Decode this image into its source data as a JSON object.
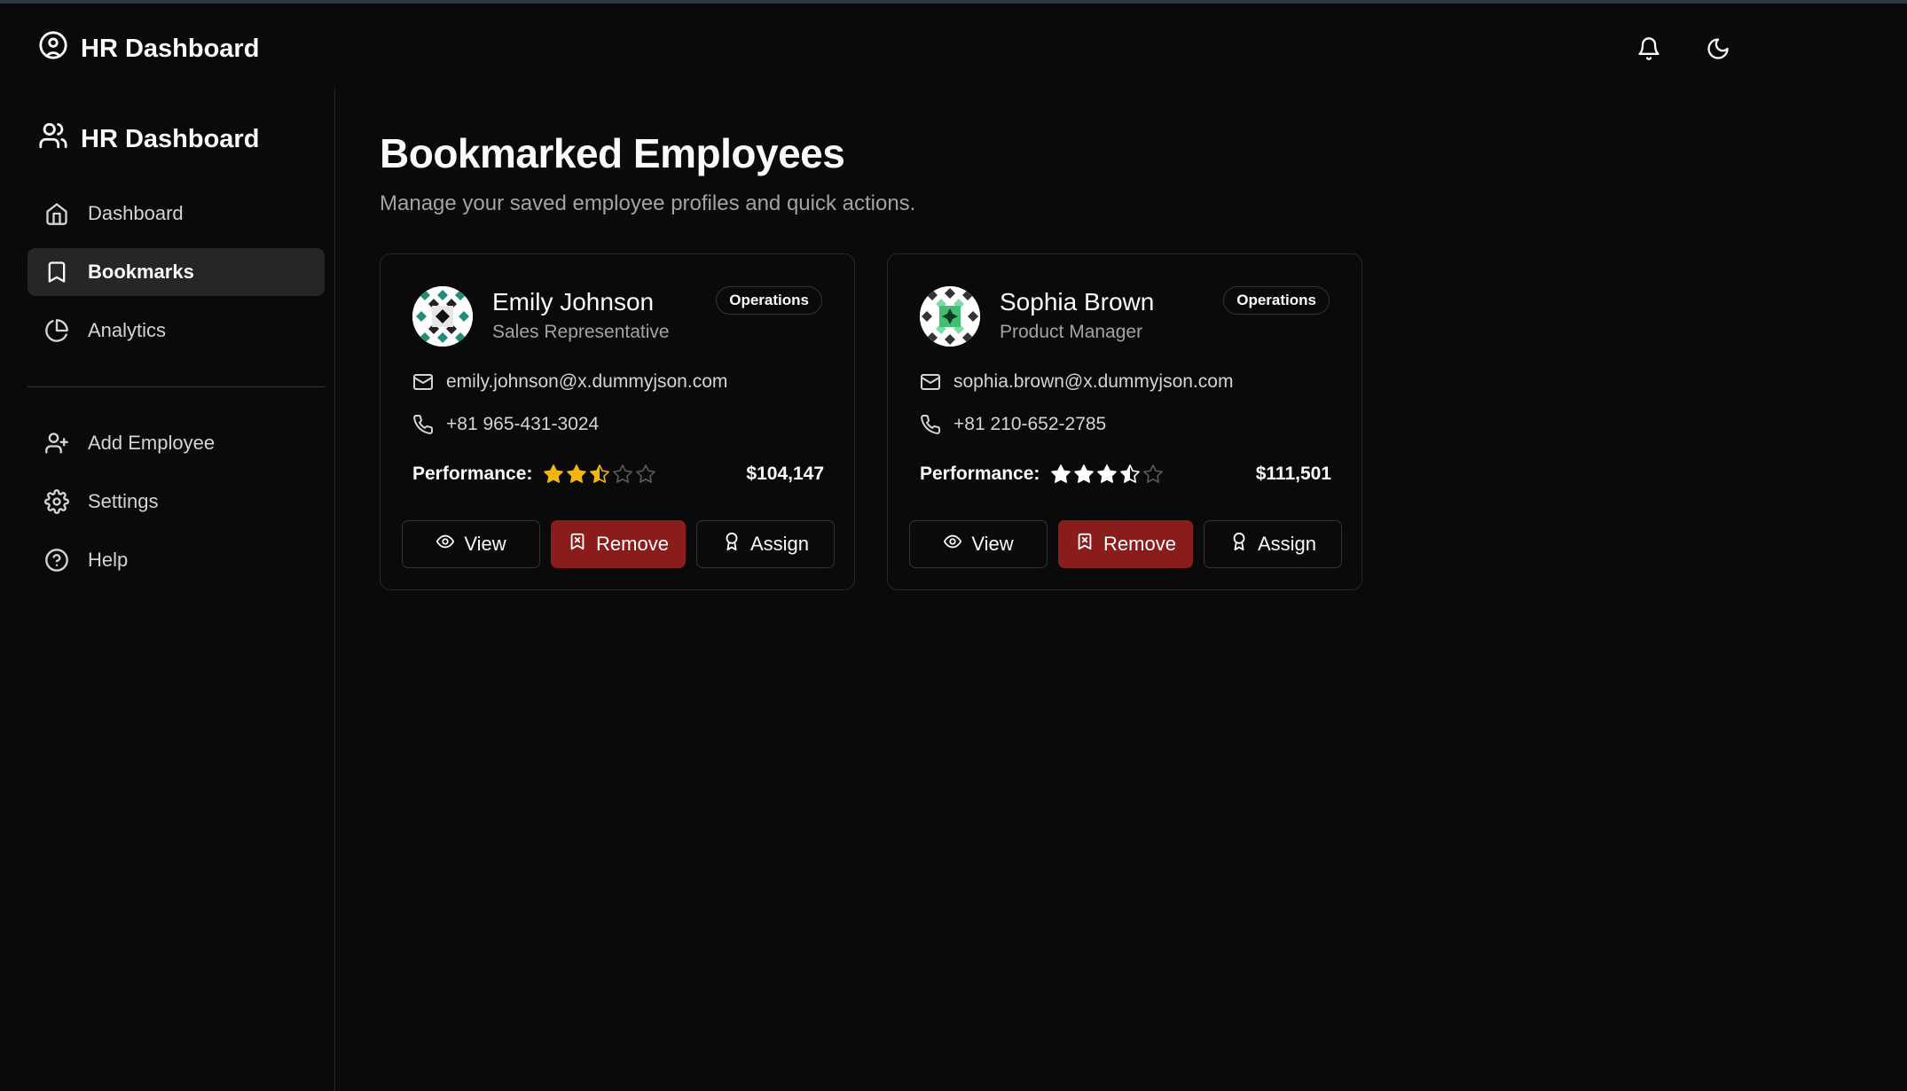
{
  "topbar": {
    "brand": "HR Dashboard",
    "icons": [
      "bell-icon",
      "moon-icon"
    ]
  },
  "sidebar": {
    "brand": "HR Dashboard",
    "items": [
      {
        "label": "Dashboard",
        "icon": "home-icon",
        "active": false
      },
      {
        "label": "Bookmarks",
        "icon": "bookmark-icon",
        "active": true
      },
      {
        "label": "Analytics",
        "icon": "pie-chart-icon",
        "active": false
      },
      {
        "label": "Add Employee",
        "icon": "user-plus-icon",
        "active": false
      },
      {
        "label": "Settings",
        "icon": "gear-icon",
        "active": false
      },
      {
        "label": "Help",
        "icon": "help-icon",
        "active": false
      }
    ]
  },
  "main": {
    "title": "Bookmarked Employees",
    "subtitle": "Manage your saved employee profiles and quick actions.",
    "performance_label": "Performance:",
    "buttons": {
      "view": "View",
      "remove": "Remove",
      "assign": "Assign"
    },
    "employees": [
      {
        "name": "Emily Johnson",
        "role": "Sales Representative",
        "department": "Operations",
        "email": "emily.johnson@x.dummyjson.com",
        "phone": "+81 965-431-3024",
        "rating": 2.5,
        "rating_max": 5,
        "star_color": "#f5b50a",
        "salary": "$104,147"
      },
      {
        "name": "Sophia Brown",
        "role": "Product Manager",
        "department": "Operations",
        "email": "sophia.brown@x.dummyjson.com",
        "phone": "+81 210-652-2785",
        "rating": 3.5,
        "rating_max": 5,
        "star_color": "#ffffff",
        "salary": "$111,501"
      }
    ]
  },
  "colors": {
    "background": "#0a0a0a",
    "active_nav": "#262626",
    "danger": "#8b1c1c"
  }
}
